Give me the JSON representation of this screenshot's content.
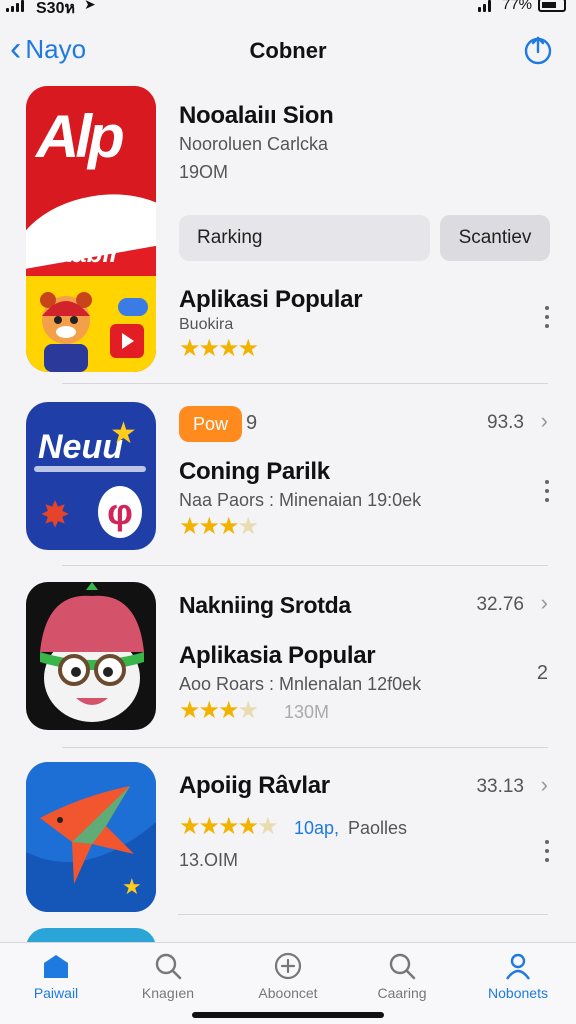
{
  "status": {
    "carrier": "S30ห",
    "battery": "77%"
  },
  "nav": {
    "back_label": "Nayo",
    "title": "Cobner"
  },
  "featured": {
    "icon_text_top": "Alp",
    "icon_text_mid": "Maabir",
    "name": "Nooalaiıı Sion",
    "developer": "Nooroluen Carlcka",
    "size": "19OM",
    "ranking_label": "Rarking",
    "scan_label": "Scantiev",
    "section_title": "Aplikasi Popular",
    "section_sub": "Buokira",
    "rating": 4
  },
  "apps": [
    {
      "icon_text": "Neuu",
      "badge": "Pow",
      "badge_count": "9",
      "score": "93.3",
      "name": "Coning Parilk",
      "meta": "Naa Paors : Minenaian 19:0ek",
      "rating": 3.5
    },
    {
      "name": "Nakniing Srotda",
      "score": "32.76",
      "name2": "Aplikasia Popular",
      "count": "2",
      "meta": "Aoo Roars : Mnlenalan 12f0ek",
      "rating": 3.5,
      "extra": "130M"
    },
    {
      "name": "Apoiig Râvlar",
      "score": "33.13",
      "rating_extra": "10ap,",
      "category": "Paolles",
      "size": "13.OIM",
      "rating": 4
    }
  ],
  "tabs": [
    {
      "label": "Paiwail",
      "icon": "store-icon",
      "active": true
    },
    {
      "label": "Knagıen",
      "icon": "search-icon",
      "active": false
    },
    {
      "label": "Abooncet",
      "icon": "add-icon",
      "active": false
    },
    {
      "label": "Caaring",
      "icon": "search-icon",
      "active": false
    },
    {
      "label": "Nobonets",
      "icon": "person-icon",
      "active": true
    }
  ],
  "colors": {
    "accent": "#1f7ae0",
    "star": "#f2b300",
    "badge": "#ff8a1d"
  }
}
